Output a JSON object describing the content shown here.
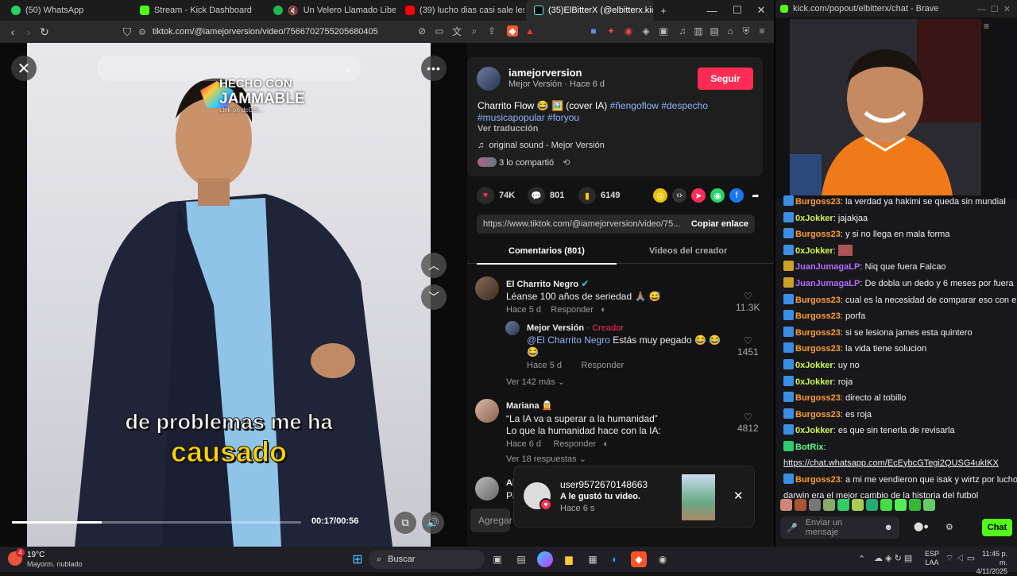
{
  "tabs": [
    {
      "title": "(50) WhatsApp",
      "color": "#25d366"
    },
    {
      "title": "Stream - Kick Dashboard",
      "color": "#53fc18"
    },
    {
      "title": "Un Velero Llamado Libertad • Jos",
      "color": "#1db954"
    },
    {
      "title": "(39) lucho dias casi sale lesionado - Y",
      "color": "#ff0000"
    },
    {
      "title": "(35)ElBitterX (@elbitterx.kick)",
      "color": "#111111"
    }
  ],
  "address_bar": {
    "url": "tiktok.com/@iamejorversion/video/7566702755205680405"
  },
  "video": {
    "search_placeholder": "Buscar contenido relacionado",
    "watermark_line1": "HECHO CON",
    "watermark_line2": "JAMMABLE",
    "watermark_line3": "Link on dcChr...",
    "caption_line1": "de problemas me ha",
    "caption_line2": "causado",
    "time": "00:17/00:56",
    "progress": 0.31
  },
  "post": {
    "username": "iamejorversion",
    "display_meta": "Mejor Versión · Hace 6 d",
    "follow_label": "Seguir",
    "caption_text": "Charrito Flow 😂 🖼️ (cover IA)",
    "hashtags_line1": "#ñengoflow #despecho",
    "hashtags_line2": "#musicapopular #foryou",
    "translate": "Ver traducción",
    "sound": "original sound - Mejor Versión",
    "shared": "3 lo compartió",
    "likes": "74K",
    "comments": "801",
    "saves": "6149",
    "link": "https://www.tiktok.com/@iamejorversion/video/75...",
    "copy_link": "Copiar enlace"
  },
  "comment_tabs": {
    "comments": "Comentarios (801)",
    "creator": "Videos del creador"
  },
  "comments": [
    {
      "name": "El Charrito Negro",
      "text": "Léanse 100 años de seriedad 🙏🏽 😅",
      "time": "Hace 5 d",
      "reply": "Responder",
      "likes": "11.3K"
    },
    {
      "name": "Mejor Versión",
      "tag": "· Creador",
      "mention": "@El Charrito Negro",
      "text": "Estás muy pegado 😂 😂 😂",
      "time": "Hace 5 d",
      "reply": "Responder",
      "likes": "1451"
    },
    {
      "more": "Ver 142 más"
    },
    {
      "name": "Mariana 🧝",
      "line1": "“La IA va a superar a la humanidad”",
      "line2": "Lo que la humanidad hace con la IA:",
      "time": "Hace 6 d",
      "reply": "Responder",
      "likes": "4812",
      "more": "Ver 18 respuestas"
    },
    {
      "name": "Al",
      "text": "Pa"
    }
  ],
  "add_comment": "Agregar",
  "notification": {
    "user": "user9572670148663",
    "text": "A le gustó tu video.",
    "time": "Hace 6 s"
  },
  "chat": {
    "window_title": "kick.com/popout/elbitterx/chat - Brave",
    "messages": [
      {
        "user": "Burgoss23",
        "text": "la verdad ya hakimi se queda sin mundial",
        "cls": "u1"
      },
      {
        "user": "0xJokker",
        "text": "jajakjaa",
        "cls": "u2"
      },
      {
        "user": "Burgoss23",
        "text": "y si no llega en mala forma",
        "cls": "u1"
      },
      {
        "user": "0xJokker",
        "text": "",
        "cls": "u2"
      },
      {
        "user": "JuanJumagaLP",
        "text": "Niq que fuera Falcao",
        "cls": "u3"
      },
      {
        "user": "JuanJumagaLP",
        "text": "De dobla un dedo y 6 meses por fuera",
        "cls": "u3"
      },
      {
        "user": "Burgoss23",
        "text": "cual es la necesidad de comparar eso con el fpc",
        "cls": "u1"
      },
      {
        "user": "Burgoss23",
        "text": "porfa",
        "cls": "u1"
      },
      {
        "user": "Burgoss23",
        "text": "si se lesiona james esta quintero",
        "cls": "u1"
      },
      {
        "user": "Burgoss23",
        "text": "la vida tiene solucion",
        "cls": "u1"
      },
      {
        "user": "0xJokker",
        "text": "uy no",
        "cls": "u2"
      },
      {
        "user": "0xJokker",
        "text": "roja",
        "cls": "u2"
      },
      {
        "user": "Burgoss23",
        "text": "directo al tobillo",
        "cls": "u1"
      },
      {
        "user": "Burgoss23",
        "text": "es roja",
        "cls": "u1"
      },
      {
        "user": "0xJokker",
        "text": "es que sin tenerla de revisarla",
        "cls": "u2"
      },
      {
        "user": "BotRix",
        "text": "",
        "cls": "u4"
      },
      {
        "user": "",
        "text": "https://chat.whatsapp.com/EcEybcGTegi2QUSG4ukIKX",
        "cls": ""
      },
      {
        "user": "Burgoss23",
        "text": "a mi me vendieron que isak y wirtz por lucho y",
        "cls": "u1"
      },
      {
        "user": "",
        "text": "darwin era el mejor cambio de la historia del futbol",
        "cls": ""
      }
    ],
    "input_placeholder": "Enviar un mensaje",
    "send_label": "Chat"
  },
  "taskbar": {
    "weather_temp": "19°C",
    "weather_desc": "Mayorm. nublado",
    "weather_badge": "4",
    "search": "Buscar",
    "lang1": "ESP",
    "lang2": "LAA",
    "time": "11:45 p. m.",
    "date": "4/11/2025"
  }
}
